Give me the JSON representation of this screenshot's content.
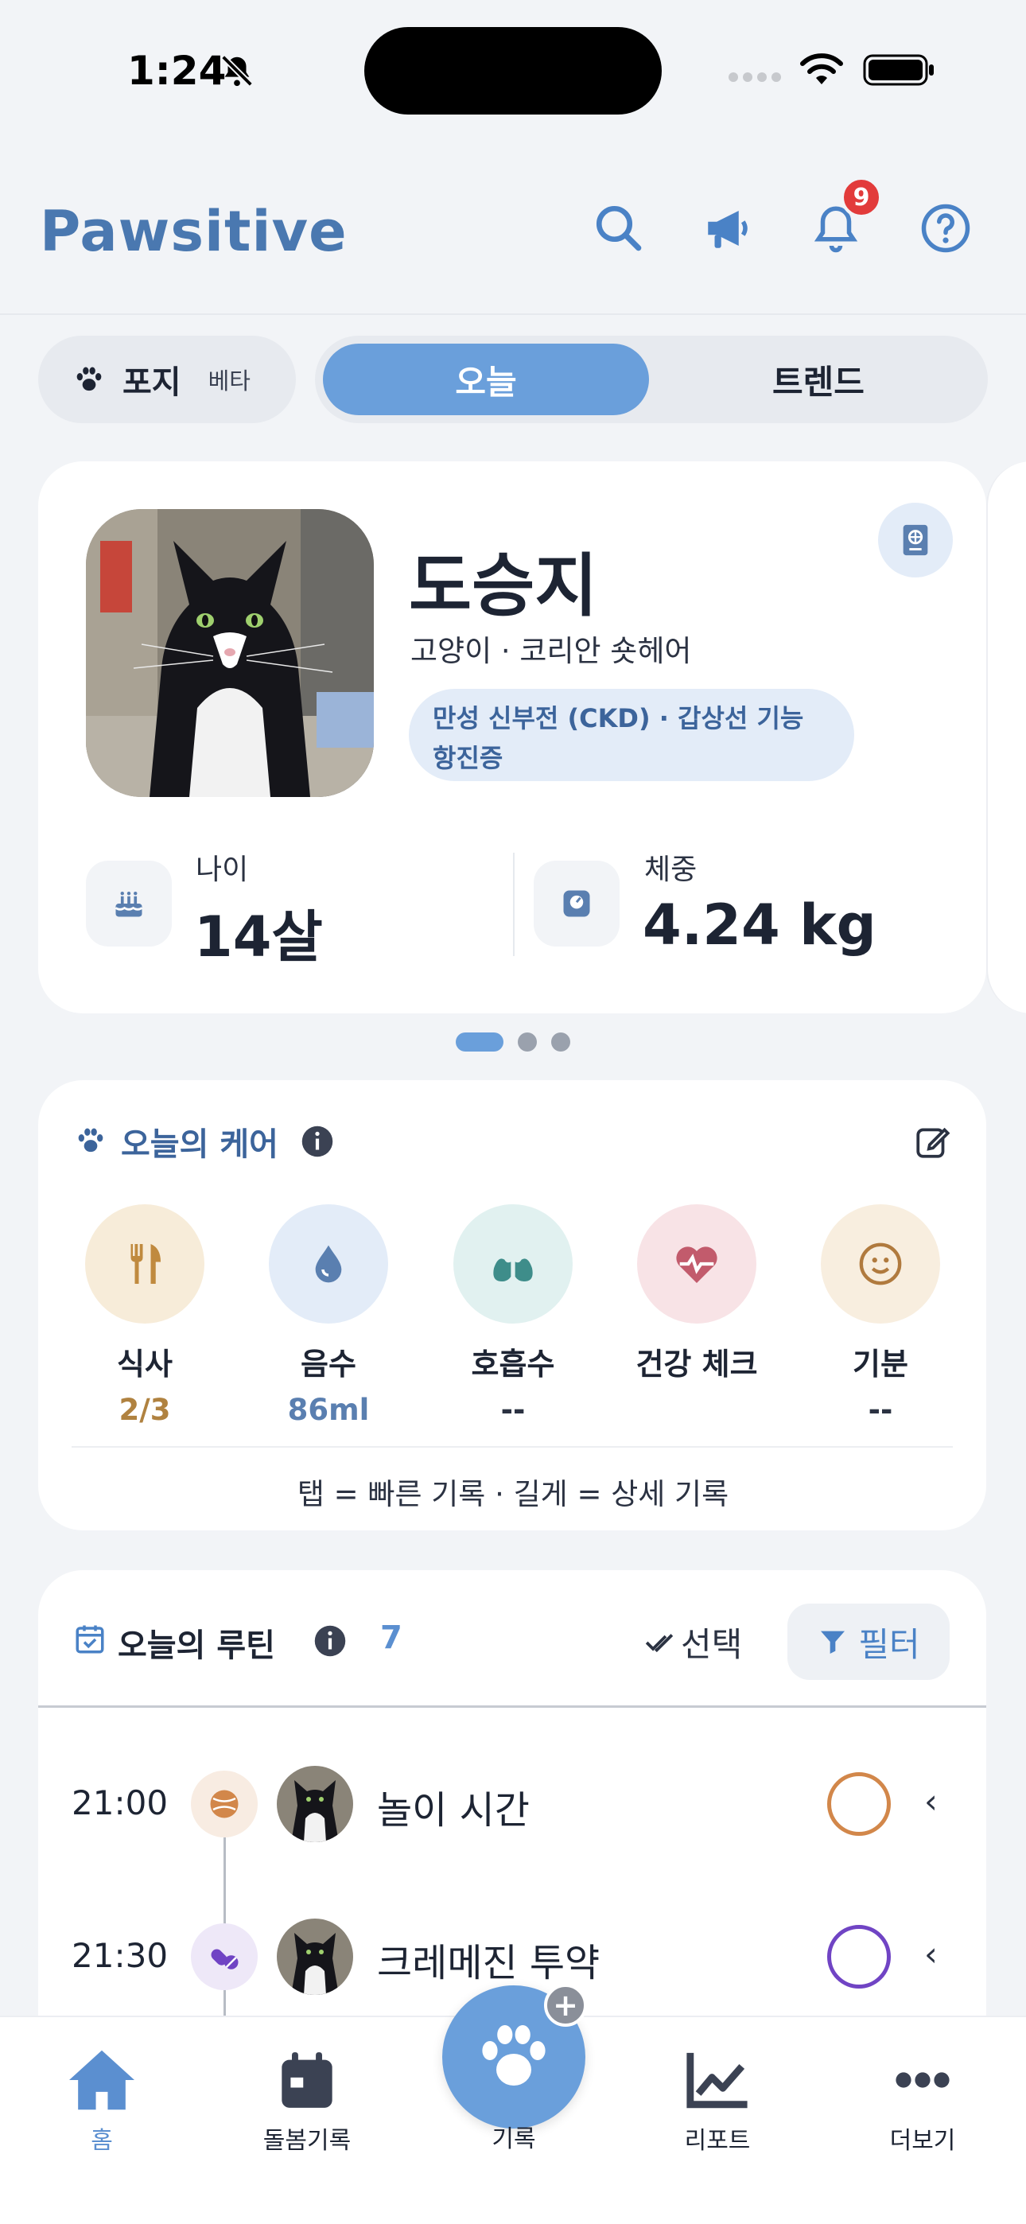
{
  "status_bar": {
    "time": "1:24"
  },
  "header": {
    "title": "Pawsitive",
    "notification_count": "9",
    "icons": [
      "search-icon",
      "megaphone-icon",
      "bell-icon",
      "help-icon"
    ]
  },
  "pet_selector": {
    "name": "포지",
    "badge": "베타"
  },
  "tabs": {
    "active": "오늘",
    "inactive": "트렌드"
  },
  "profile": {
    "name": "도승지",
    "breed": "고양이 · 코리안 숏헤어",
    "conditions": "만성 신부전 (CKD) · 갑상선 기능 항진증",
    "age_label": "나이",
    "age_value": "14살",
    "weight_label": "체중",
    "weight_value": "4.24 kg"
  },
  "pager": {
    "count": 3,
    "active_index": 0
  },
  "care": {
    "title": "오늘의 케어",
    "hint": "탭 = 빠른 기록 · 길게 = 상세 기록",
    "items": [
      {
        "label": "식사",
        "value": "2/3",
        "icon": "fork-knife-icon",
        "color": "#c08a3e",
        "bg": "#f7ecd9"
      },
      {
        "label": "음수",
        "value": "86ml",
        "icon": "water-drop-icon",
        "color": "#5a7fb0",
        "bg": "#e3ecf8"
      },
      {
        "label": "호흡수",
        "value": "--",
        "icon": "lungs-icon",
        "color": "#3e8d8a",
        "bg": "#e1f1f0"
      },
      {
        "label": "건강 체크",
        "value": "",
        "icon": "heart-pulse-icon",
        "color": "#c25b6c",
        "bg": "#f8e3e6"
      },
      {
        "label": "기분",
        "value": "--",
        "icon": "smile-icon",
        "color": "#b07a3e",
        "bg": "#f8eedf"
      }
    ]
  },
  "routine": {
    "title": "오늘의 루틴",
    "count": "7",
    "select_label": "선택",
    "filter_label": "필터",
    "items": [
      {
        "time": "21:00",
        "name": "놀이 시간",
        "type_icon": "ball-icon",
        "color": "#d2874a",
        "type_bg": "#f8ece2"
      },
      {
        "time": "21:30",
        "name": "크레메진 투약",
        "type_icon": "pill-icon",
        "color": "#7044c4",
        "type_bg": "#eee8f8"
      }
    ]
  },
  "bottom_nav": {
    "items": [
      {
        "label": "홈",
        "icon": "home-icon",
        "active": true
      },
      {
        "label": "돌봄기록",
        "icon": "calendar-icon",
        "active": false
      },
      {
        "label": "기록",
        "icon": "paw-icon",
        "active": false
      },
      {
        "label": "리포트",
        "icon": "chart-icon",
        "active": false
      },
      {
        "label": "더보기",
        "icon": "more-icon",
        "active": false
      }
    ]
  },
  "colors": {
    "accent": "#6a9fdb",
    "brand": "#4a78b0",
    "badge": "#e23b3b"
  }
}
